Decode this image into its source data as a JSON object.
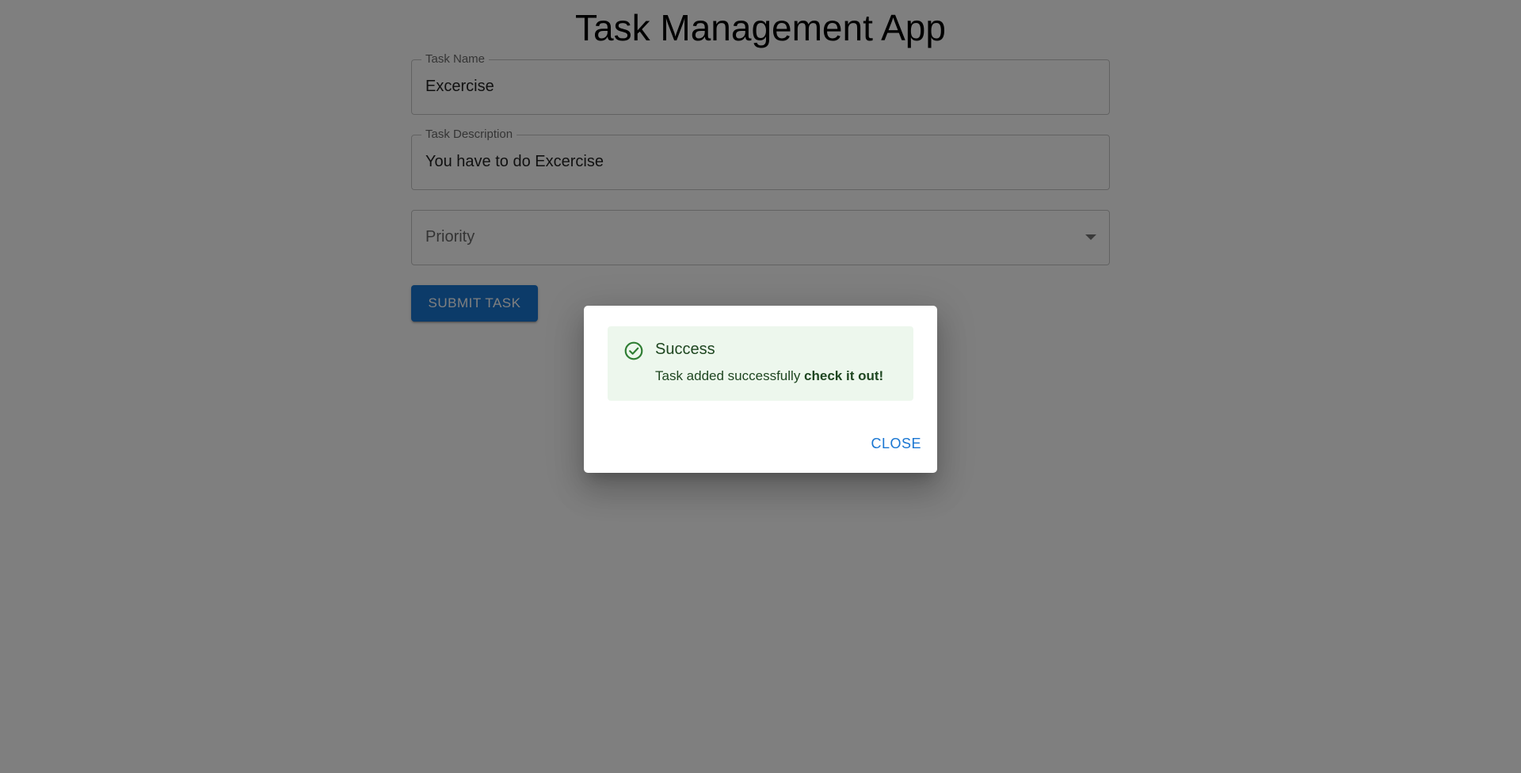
{
  "app": {
    "title": "Task Management App"
  },
  "form": {
    "task_name": {
      "label": "Task Name",
      "value": "Excercise"
    },
    "task_description": {
      "label": "Task Description",
      "value": "You have to do Excercise"
    },
    "priority": {
      "placeholder": "Priority",
      "value": ""
    },
    "submit_label": "SUBMIT TASK"
  },
  "dialog": {
    "alert": {
      "icon": "check-circle-icon",
      "title": "Success",
      "message_text": "Task added successfully ",
      "message_emphasis": "check it out!"
    },
    "close_label": "CLOSE"
  },
  "colors": {
    "primary": "#1976d2",
    "success_bg": "#edf7ed",
    "success_text": "#1e4620",
    "success_icon": "#2e7d32",
    "backdrop": "rgba(0,0,0,0.5)"
  }
}
